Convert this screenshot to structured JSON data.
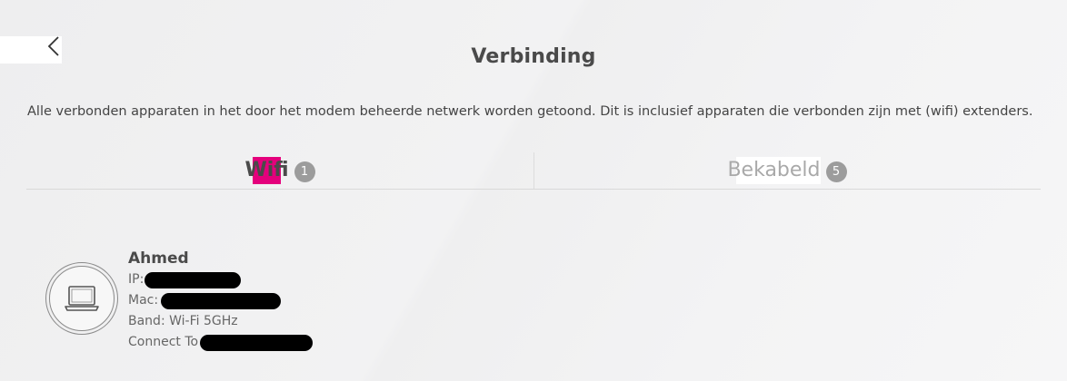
{
  "header": {
    "title": "Verbinding",
    "back_icon": "chevron-left-icon"
  },
  "description": "Alle verbonden apparaten in het door het modem beheerde netwerk worden getoond. Dit is inclusief apparaten die verbonden zijn met (wifi) extenders.",
  "tabs": [
    {
      "label": "Wifi",
      "count": "1",
      "active": true
    },
    {
      "label": "Bekabeld",
      "count": "5",
      "active": false
    }
  ],
  "colors": {
    "accent": "#e4007c",
    "badge": "#9c9c9c",
    "text": "#444444",
    "muted": "#a9a9a9"
  },
  "device": {
    "name": "Ahmed",
    "icon": "laptop-icon",
    "ip_label": "IP:",
    "mac_label": "Mac:",
    "band_text": "Band: Wi-Fi 5GHz",
    "connect_label": "Connect To"
  }
}
